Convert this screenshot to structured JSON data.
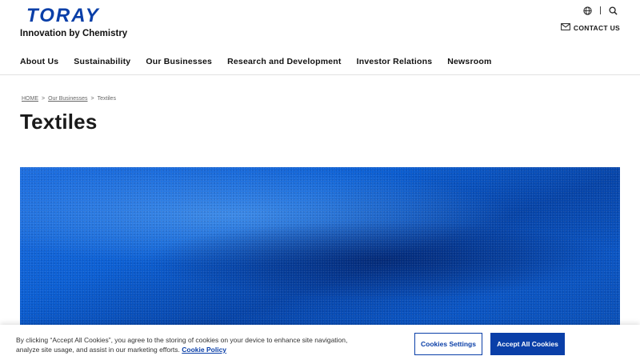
{
  "header": {
    "logo_text": "TORAY",
    "tagline": "Innovation by Chemistry",
    "language_icon": "globe-icon",
    "search_icon": "search-icon",
    "contact_icon": "envelope-icon",
    "contact_label": "CONTACT US"
  },
  "nav": {
    "items": [
      {
        "label": "About Us"
      },
      {
        "label": "Sustainability"
      },
      {
        "label": "Our Businesses"
      },
      {
        "label": "Research and Development"
      },
      {
        "label": "Investor Relations"
      },
      {
        "label": "Newsroom"
      }
    ]
  },
  "breadcrumb": {
    "home": "HOME",
    "sep": ">",
    "parent": "Our Businesses",
    "current": "Textiles"
  },
  "page": {
    "title": "Textiles"
  },
  "cookie": {
    "text": "By clicking “Accept All Cookies”, you agree to the storing of cookies on your device to enhance site navigation, analyze site usage, and assist in our marketing efforts.",
    "policy_link": "Cookie Policy",
    "settings_label": "Cookies Settings",
    "accept_label": "Accept All Cookies"
  },
  "colors": {
    "brand": "#0a3fa8",
    "hero_blue": "#0b5fd4"
  }
}
